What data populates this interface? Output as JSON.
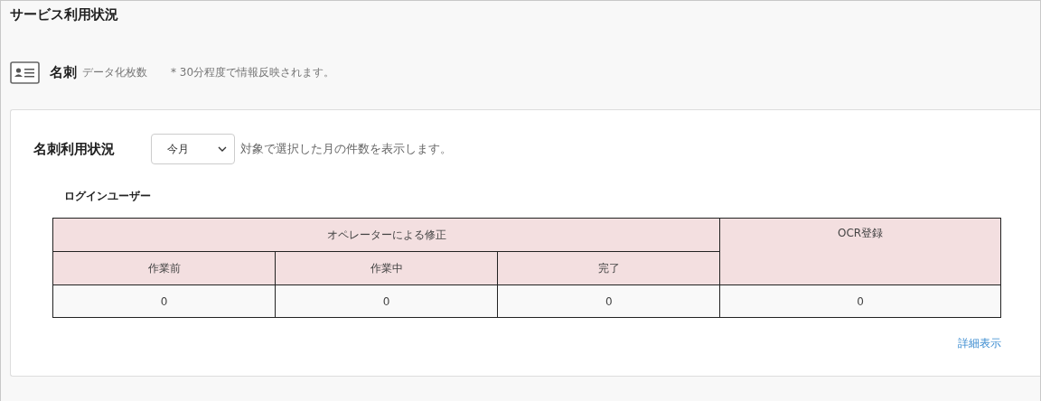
{
  "page": {
    "title": "サービス利用状況"
  },
  "service": {
    "name": "名刺",
    "label": "データ化枚数",
    "note": "* 30分程度で情報反映されます。"
  },
  "card": {
    "title": "名刺利用状況",
    "period_select": {
      "value": "今月"
    },
    "description": "対象で選択した月の件数を表示します。",
    "section_title": "ログインユーザー",
    "table": {
      "group_header": "オペレーターによる修正",
      "columns": [
        "作業前",
        "作業中",
        "完了"
      ],
      "ocr_header": "OCR登録",
      "rows": [
        {
          "cells": [
            "0",
            "0",
            "0",
            "0"
          ]
        }
      ]
    },
    "link": "詳細表示"
  }
}
